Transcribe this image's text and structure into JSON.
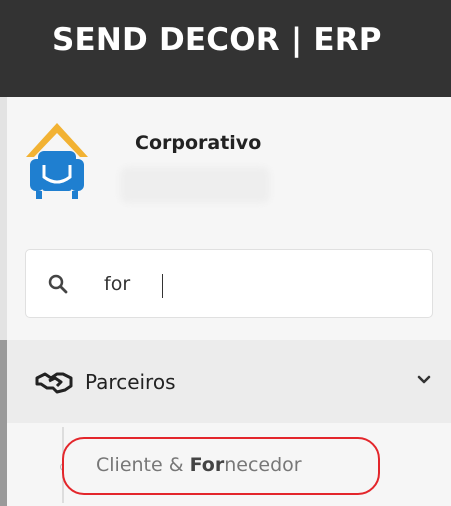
{
  "header": {
    "title": "SEND DECOR | ERP"
  },
  "profile": {
    "name": "Corporativo",
    "logo_icon": "armchair-house-icon"
  },
  "search": {
    "value": "for",
    "icon": "search-icon"
  },
  "nav": {
    "group_label": "Parceiros",
    "group_icon": "handshake-icon",
    "expanded": true,
    "submenu": {
      "label_before": "Cliente & ",
      "label_match": "For",
      "label_after": "necedor"
    }
  },
  "colors": {
    "header_bg": "#333333",
    "highlight_outline": "#e3262b",
    "logo_roof": "#f2b233",
    "logo_chair": "#1f7fd0"
  }
}
